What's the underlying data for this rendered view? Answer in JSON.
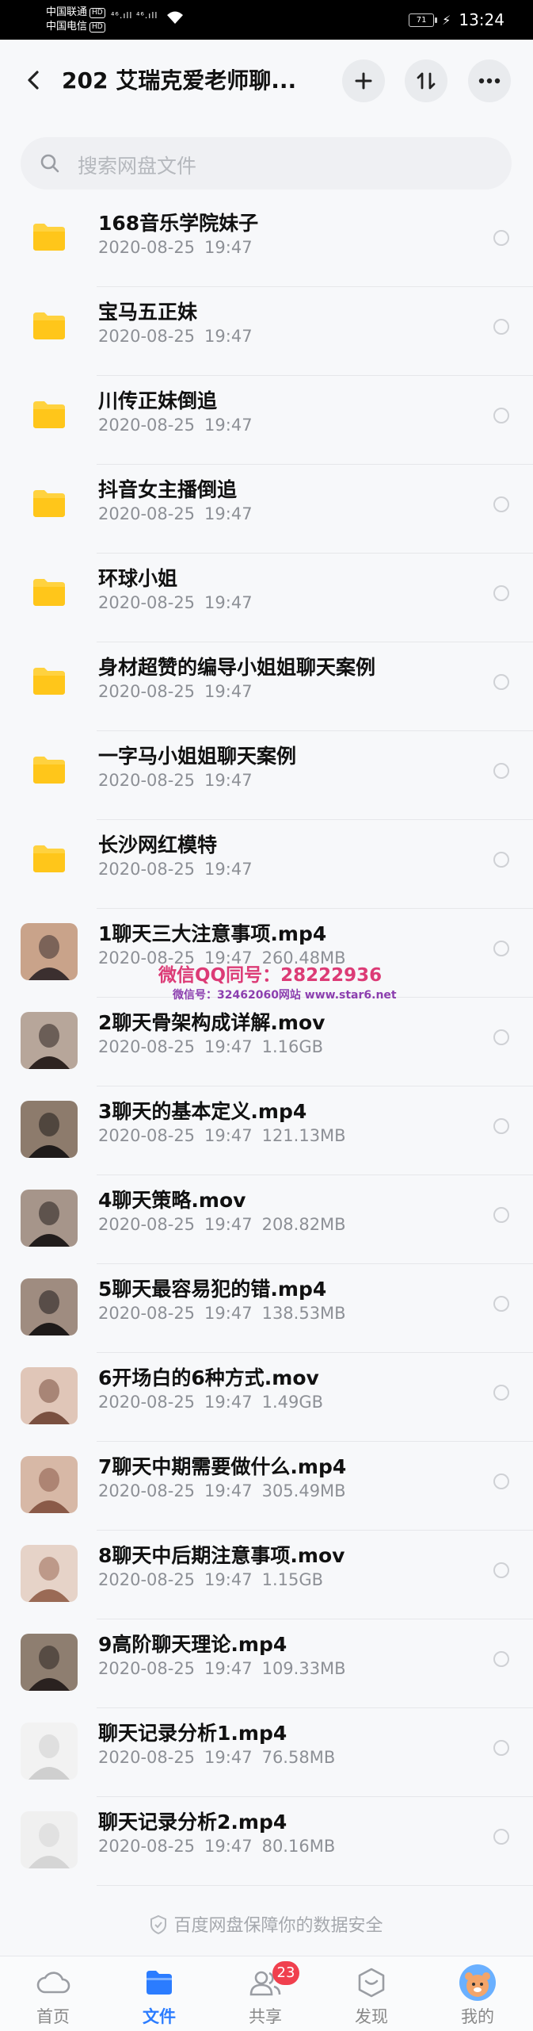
{
  "status_bar": {
    "carrier1": "中国联通",
    "carrier2": "中国电信",
    "hd": "HD",
    "network": "⁴⁶.ıll ⁴⁶.ıll",
    "battery": "71",
    "time": "13:24"
  },
  "header": {
    "title": "202 艾瑞克爱老师聊..."
  },
  "search": {
    "placeholder": "搜索网盘文件"
  },
  "files": [
    {
      "type": "folder",
      "name": "168音乐学院妹子",
      "date": "2020-08-25",
      "time": "19:47",
      "size": ""
    },
    {
      "type": "folder",
      "name": "宝马五正妹",
      "date": "2020-08-25",
      "time": "19:47",
      "size": ""
    },
    {
      "type": "folder",
      "name": "川传正妹倒追",
      "date": "2020-08-25",
      "time": "19:47",
      "size": ""
    },
    {
      "type": "folder",
      "name": "抖音女主播倒追",
      "date": "2020-08-25",
      "time": "19:47",
      "size": ""
    },
    {
      "type": "folder",
      "name": "环球小姐",
      "date": "2020-08-25",
      "time": "19:47",
      "size": ""
    },
    {
      "type": "folder",
      "name": "身材超赞的编导小姐姐聊天案例",
      "date": "2020-08-25",
      "time": "19:47",
      "size": ""
    },
    {
      "type": "folder",
      "name": "一字马小姐姐聊天案例",
      "date": "2020-08-25",
      "time": "19:47",
      "size": ""
    },
    {
      "type": "folder",
      "name": "长沙网红模特",
      "date": "2020-08-25",
      "time": "19:47",
      "size": ""
    },
    {
      "type": "video",
      "name": "1聊天三大注意事项.mp4",
      "date": "2020-08-25",
      "time": "19:47",
      "size": "260.48MB"
    },
    {
      "type": "video",
      "name": "2聊天骨架构成详解.mov",
      "date": "2020-08-25",
      "time": "19:47",
      "size": "1.16GB"
    },
    {
      "type": "video",
      "name": "3聊天的基本定义.mp4",
      "date": "2020-08-25",
      "time": "19:47",
      "size": "121.13MB"
    },
    {
      "type": "video",
      "name": "4聊天策略.mov",
      "date": "2020-08-25",
      "time": "19:47",
      "size": "208.82MB"
    },
    {
      "type": "video",
      "name": "5聊天最容易犯的错.mp4",
      "date": "2020-08-25",
      "time": "19:47",
      "size": "138.53MB"
    },
    {
      "type": "video",
      "name": "6开场白的6种方式.mov",
      "date": "2020-08-25",
      "time": "19:47",
      "size": "1.49GB"
    },
    {
      "type": "video",
      "name": "7聊天中期需要做什么.mp4",
      "date": "2020-08-25",
      "time": "19:47",
      "size": "305.49MB"
    },
    {
      "type": "video",
      "name": "8聊天中后期注意事项.mov",
      "date": "2020-08-25",
      "time": "19:47",
      "size": "1.15GB"
    },
    {
      "type": "video",
      "name": "9高阶聊天理论.mp4",
      "date": "2020-08-25",
      "time": "19:47",
      "size": "109.33MB"
    },
    {
      "type": "video",
      "name": "聊天记录分析1.mp4",
      "date": "2020-08-25",
      "time": "19:47",
      "size": "76.58MB"
    },
    {
      "type": "video",
      "name": "聊天记录分析2.mp4",
      "date": "2020-08-25",
      "time": "19:47",
      "size": "80.16MB"
    }
  ],
  "watermark": {
    "line1": "微信QQ同号：28222936",
    "line2": "微信号：32462060网站 www.star6.net"
  },
  "footer_note": "百度网盘保障你的数据安全",
  "tabs": [
    {
      "label": "首页",
      "icon": "cloud-icon",
      "active": false,
      "badge": ""
    },
    {
      "label": "文件",
      "icon": "file-icon",
      "active": true,
      "badge": ""
    },
    {
      "label": "共享",
      "icon": "share-users-icon",
      "active": false,
      "badge": "23"
    },
    {
      "label": "发现",
      "icon": "discover-icon",
      "active": false,
      "badge": ""
    },
    {
      "label": "我的",
      "icon": "avatar-icon",
      "active": false,
      "badge": ""
    }
  ],
  "colors": {
    "accent": "#2b7cff",
    "folder": "#ffd23f",
    "badge": "#f0404e"
  }
}
